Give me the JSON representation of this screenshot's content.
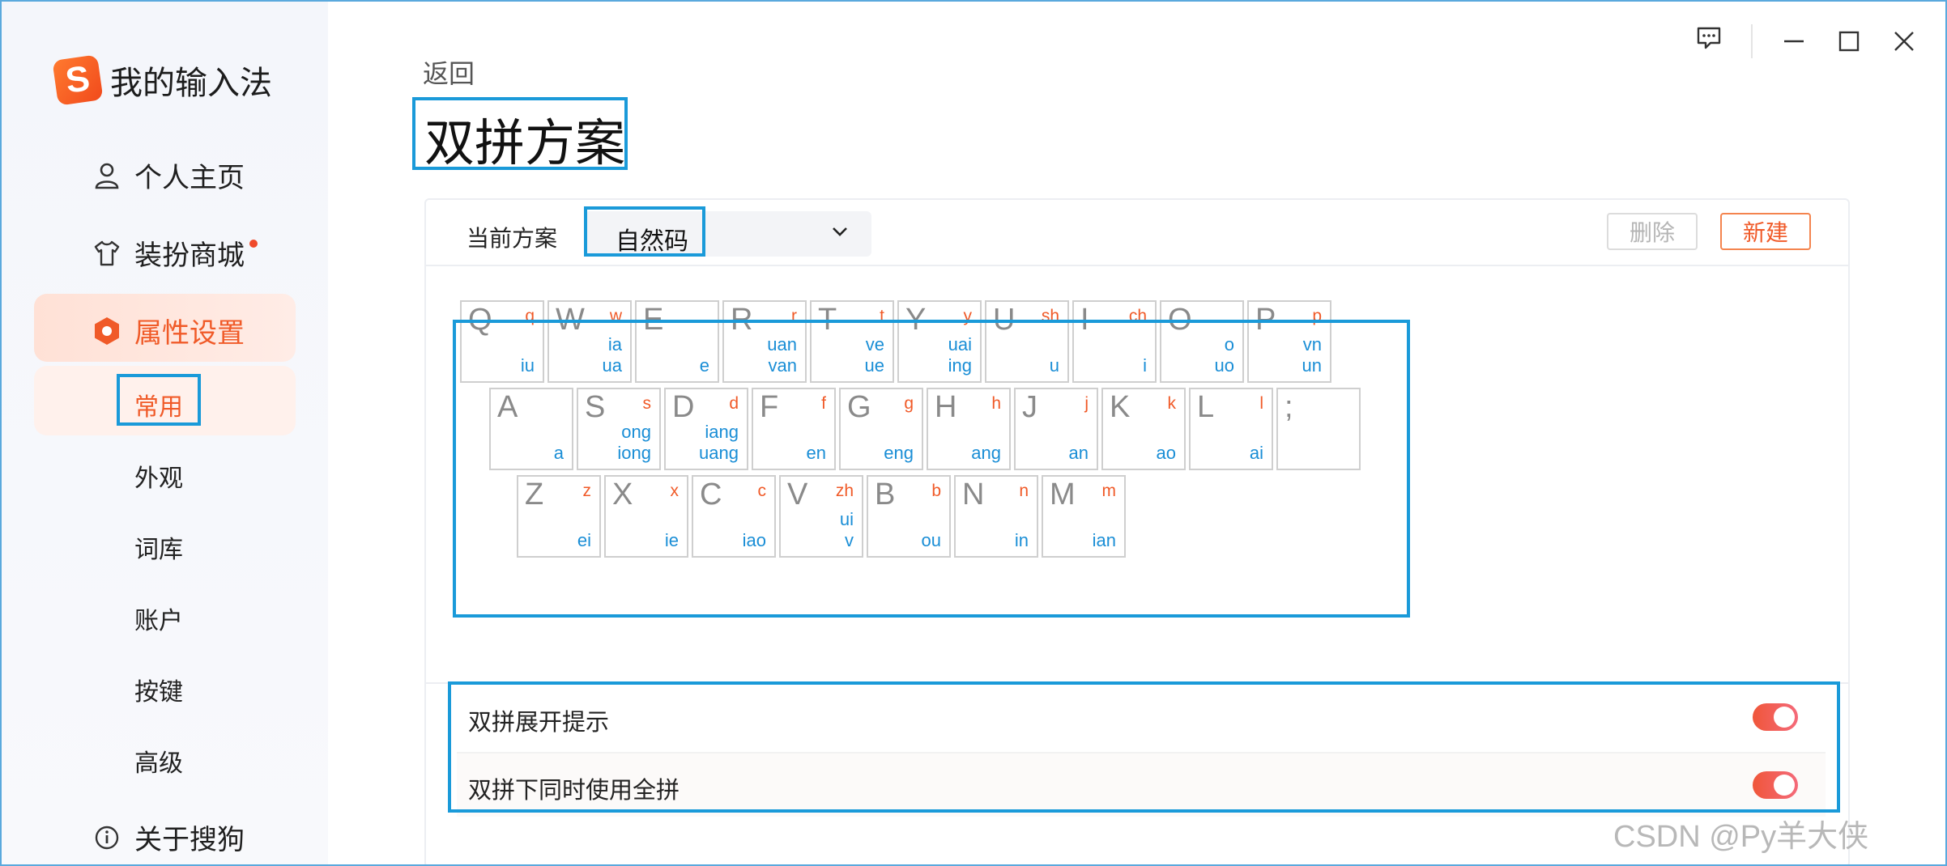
{
  "app": {
    "title": "我的输入法",
    "logo_letter": "S"
  },
  "nav": {
    "home": "个人主页",
    "skin_store": "装扮商城",
    "settings": "属性设置",
    "about": "关于搜狗"
  },
  "subnav": [
    "常用",
    "外观",
    "词库",
    "账户",
    "按键",
    "高级"
  ],
  "page": {
    "back": "返回",
    "title": "双拼方案"
  },
  "scheme": {
    "current_label": "当前方案",
    "selected": "自然码",
    "delete_label": "删除",
    "new_label": "新建"
  },
  "keyboard": {
    "rows": [
      [
        {
          "letter": "Q",
          "initial": "q",
          "finals": [
            "iu"
          ]
        },
        {
          "letter": "W",
          "initial": "w",
          "finals": [
            "ia",
            "ua"
          ]
        },
        {
          "letter": "E",
          "initial": "",
          "finals": [
            "e"
          ]
        },
        {
          "letter": "R",
          "initial": "r",
          "finals": [
            "uan",
            "van"
          ]
        },
        {
          "letter": "T",
          "initial": "t",
          "finals": [
            "ve",
            "ue"
          ]
        },
        {
          "letter": "Y",
          "initial": "y",
          "finals": [
            "uai",
            "ing"
          ]
        },
        {
          "letter": "U",
          "initial": "sh",
          "finals": [
            "u"
          ]
        },
        {
          "letter": "I",
          "initial": "ch",
          "finals": [
            "i"
          ]
        },
        {
          "letter": "O",
          "initial": "",
          "finals": [
            "o",
            "uo"
          ]
        },
        {
          "letter": "P",
          "initial": "p",
          "finals": [
            "vn",
            "un"
          ]
        }
      ],
      [
        {
          "letter": "A",
          "initial": "",
          "finals": [
            "a"
          ]
        },
        {
          "letter": "S",
          "initial": "s",
          "finals": [
            "ong",
            "iong"
          ]
        },
        {
          "letter": "D",
          "initial": "d",
          "finals": [
            "iang",
            "uang"
          ]
        },
        {
          "letter": "F",
          "initial": "f",
          "finals": [
            "en"
          ]
        },
        {
          "letter": "G",
          "initial": "g",
          "finals": [
            "eng"
          ]
        },
        {
          "letter": "H",
          "initial": "h",
          "finals": [
            "ang"
          ]
        },
        {
          "letter": "J",
          "initial": "j",
          "finals": [
            "an"
          ]
        },
        {
          "letter": "K",
          "initial": "k",
          "finals": [
            "ao"
          ]
        },
        {
          "letter": "L",
          "initial": "l",
          "finals": [
            "ai"
          ]
        },
        {
          "letter": ";",
          "initial": "",
          "finals": []
        }
      ],
      [
        {
          "letter": "Z",
          "initial": "z",
          "finals": [
            "ei"
          ]
        },
        {
          "letter": "X",
          "initial": "x",
          "finals": [
            "ie"
          ]
        },
        {
          "letter": "C",
          "initial": "c",
          "finals": [
            "iao"
          ]
        },
        {
          "letter": "V",
          "initial": "zh",
          "finals": [
            "ui",
            "v"
          ]
        },
        {
          "letter": "B",
          "initial": "b",
          "finals": [
            "ou"
          ]
        },
        {
          "letter": "N",
          "initial": "n",
          "finals": [
            "in"
          ]
        },
        {
          "letter": "M",
          "initial": "m",
          "finals": [
            "ian"
          ]
        }
      ]
    ]
  },
  "options": [
    {
      "label": "双拼展开提示",
      "on": true
    },
    {
      "label": "双拼下同时使用全拼",
      "on": true
    }
  ],
  "colors": {
    "accent": "#f05a28",
    "final": "#1a8ed6",
    "highlight": "#1a9ad9"
  },
  "watermark": "CSDN @Py羊大侠"
}
